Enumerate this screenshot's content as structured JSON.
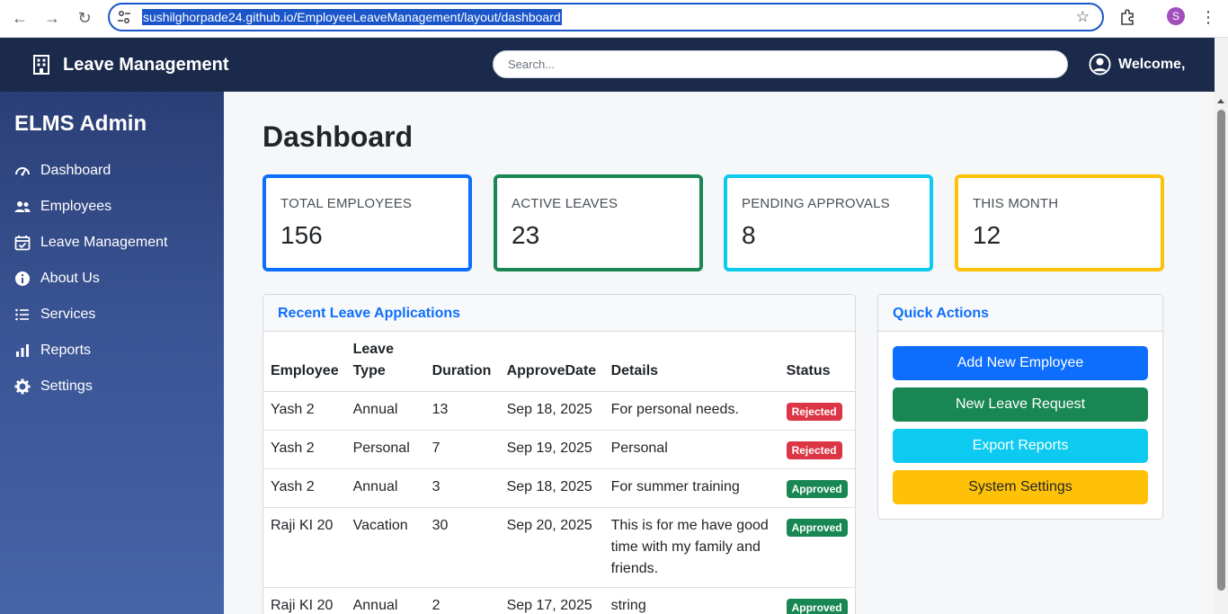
{
  "browser": {
    "url": "sushilghorpade24.github.io/EmployeeLeaveManagement/layout/dashboard",
    "profile_initial": "S"
  },
  "topbar": {
    "brand": "Leave Management",
    "search_placeholder": "Search...",
    "welcome": "Welcome,"
  },
  "sidebar": {
    "title": "ELMS Admin",
    "items": [
      {
        "label": "Dashboard",
        "icon": "gauge-icon"
      },
      {
        "label": "Employees",
        "icon": "users-icon"
      },
      {
        "label": "Leave Management",
        "icon": "calendar-check-icon"
      },
      {
        "label": "About Us",
        "icon": "info-icon"
      },
      {
        "label": "Services",
        "icon": "list-icon"
      },
      {
        "label": "Reports",
        "icon": "bar-chart-icon"
      },
      {
        "label": "Settings",
        "icon": "gear-icon"
      }
    ]
  },
  "main": {
    "title": "Dashboard",
    "stats": [
      {
        "label": "TOTAL EMPLOYEES",
        "value": "156",
        "color": "#0d6efd"
      },
      {
        "label": "ACTIVE LEAVES",
        "value": "23",
        "color": "#198754"
      },
      {
        "label": "PENDING APPROVALS",
        "value": "8",
        "color": "#0dcaf0"
      },
      {
        "label": "THIS MONTH",
        "value": "12",
        "color": "#ffc107"
      }
    ]
  },
  "recent": {
    "title": "Recent Leave Applications",
    "headers": [
      "Employee",
      "Leave Type",
      "Duration",
      "ApproveDate",
      "Details",
      "Status"
    ],
    "rows": [
      {
        "employee": "Yash 2",
        "type": "Annual",
        "duration": "13",
        "date": "Sep 18, 2025",
        "details": "For personal needs.",
        "status": "Rejected"
      },
      {
        "employee": "Yash 2",
        "type": "Personal",
        "duration": "7",
        "date": "Sep 19, 2025",
        "details": "Personal",
        "status": "Rejected"
      },
      {
        "employee": "Yash 2",
        "type": "Annual",
        "duration": "3",
        "date": "Sep 18, 2025",
        "details": "For summer training",
        "status": "Approved"
      },
      {
        "employee": "Raji KI 20",
        "type": "Vacation",
        "duration": "30",
        "date": "Sep 20, 2025",
        "details": "This is for me have good time with my family and friends.",
        "status": "Approved"
      },
      {
        "employee": "Raji KI 20",
        "type": "Annual",
        "duration": "2",
        "date": "Sep 17, 2025",
        "details": "string",
        "status": "Approved"
      }
    ]
  },
  "quick_actions": {
    "title": "Quick Actions",
    "buttons": [
      {
        "label": "Add New Employee",
        "bg": "#0d6efd",
        "fg": "#ffffff"
      },
      {
        "label": "New Leave Request",
        "bg": "#198754",
        "fg": "#ffffff"
      },
      {
        "label": "Export Reports",
        "bg": "#0dcaf0",
        "fg": "#ffffff"
      },
      {
        "label": "System Settings",
        "bg": "#ffc107",
        "fg": "#212529"
      }
    ]
  }
}
